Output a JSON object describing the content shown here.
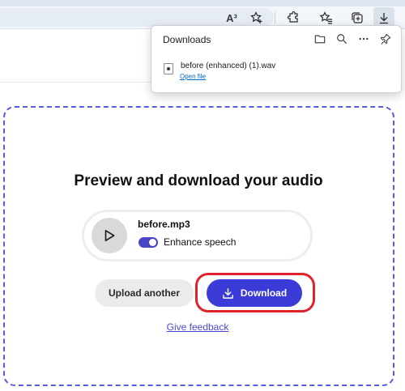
{
  "browser": {
    "toolbar_icons": [
      {
        "name": "read-aloud-icon",
        "glyph": "A³"
      },
      {
        "name": "favorite-add-icon"
      },
      {
        "name": "extensions-icon"
      },
      {
        "name": "favorites-icon"
      },
      {
        "name": "collections-icon"
      },
      {
        "name": "downloads-icon"
      }
    ]
  },
  "downloads_panel": {
    "title": "Downloads",
    "actions": [
      "folder-icon",
      "search-icon",
      "more-icon",
      "pin-icon"
    ],
    "item": {
      "filename": "before (enhanced) (1).wav",
      "open_link": "Open file"
    }
  },
  "main": {
    "heading": "Preview and download your audio",
    "file": {
      "name": "before.mp3",
      "enhance_label": "Enhance speech",
      "enhance_enabled": true
    },
    "buttons": {
      "upload_another": "Upload another",
      "download": "Download"
    },
    "feedback_link": "Give feedback"
  },
  "colors": {
    "accent": "#3b3bd8",
    "dashed_border": "#5a5ae0",
    "highlight": "#e0222a"
  }
}
